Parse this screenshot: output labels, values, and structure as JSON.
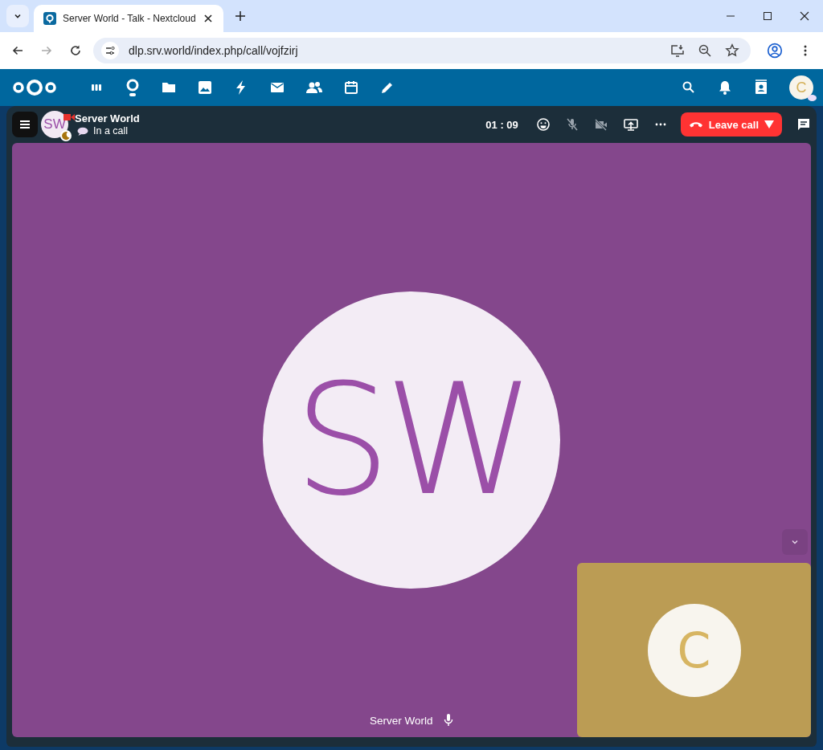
{
  "browser": {
    "tab_title": "Server World - Talk - Nextcloud",
    "url": "dlp.srv.world/index.php/call/vojfzirj"
  },
  "header": {
    "user_initial": "C"
  },
  "call": {
    "title": "Server World",
    "status": "In a call",
    "avatar_initials": "SW",
    "has_video_badge": true,
    "timer": "01 : 09",
    "microphone_muted": true,
    "camera_off": true,
    "leave_label": "Leave call"
  },
  "stage": {
    "main": {
      "initials": "SW",
      "name": "Server World",
      "color": "#84478c"
    },
    "self": {
      "initial": "C",
      "color": "#bb9c54"
    }
  }
}
